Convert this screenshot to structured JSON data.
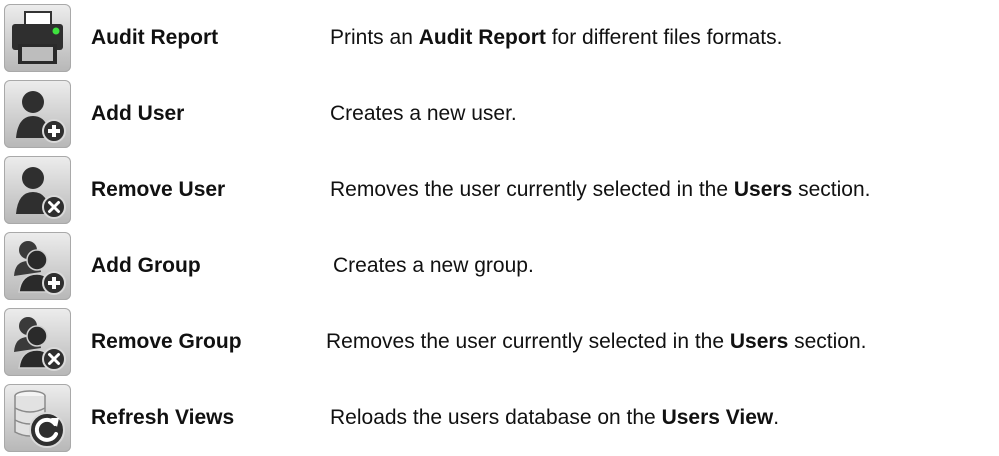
{
  "rows": [
    {
      "icon": "printer-icon",
      "name": "Audit Report",
      "desc_pre": "Prints an ",
      "desc_bold": "Audit Report",
      "desc_post": " for different files formats."
    },
    {
      "icon": "add-user-icon",
      "name": "Add User",
      "desc_pre": "Creates a new user.",
      "desc_bold": "",
      "desc_post": ""
    },
    {
      "icon": "remove-user-icon",
      "name": "Remove User",
      "desc_pre": "Removes the user currently selected in the ",
      "desc_bold": "Users",
      "desc_post": " section."
    },
    {
      "icon": "add-group-icon",
      "name": "Add Group",
      "desc_pre": "Creates a new group.",
      "desc_bold": "",
      "desc_post": ""
    },
    {
      "icon": "remove-group-icon",
      "name": "Remove Group",
      "desc_pre": "Removes the user currently selected in the ",
      "desc_bold": "Users",
      "desc_post": " section."
    },
    {
      "icon": "refresh-views-icon",
      "name": "Refresh Views",
      "desc_pre": "Reloads the users database on the ",
      "desc_bold": "Users View",
      "desc_post": "."
    }
  ]
}
